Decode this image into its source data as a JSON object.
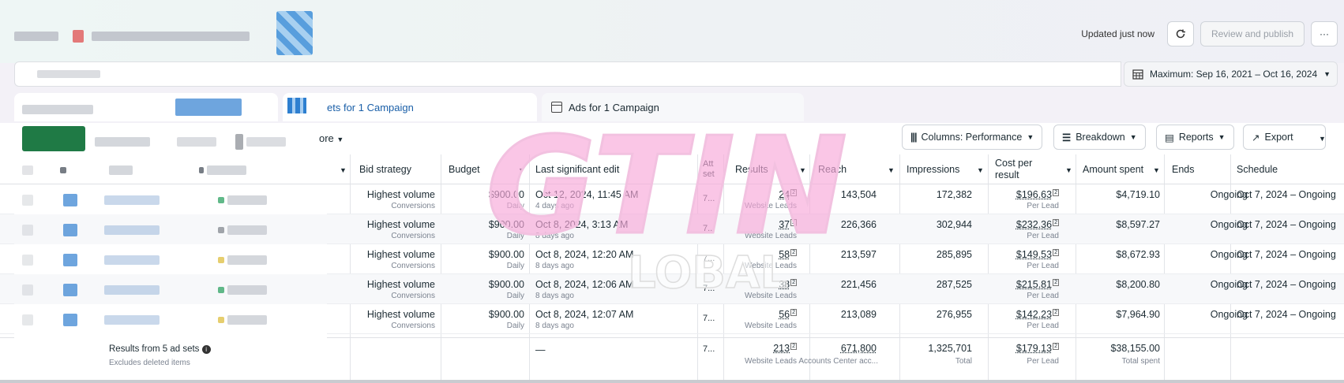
{
  "header": {
    "updated_text": "Updated just now",
    "review_label": "Review and publish",
    "more_label": "···"
  },
  "date_range": {
    "label": "Maximum: Sep 16, 2021 – Oct 16, 2024"
  },
  "tabs": [
    {
      "label": "ets for 1 Campaign",
      "active": true
    },
    {
      "label": "Ads for 1 Campaign",
      "active": false
    }
  ],
  "toolbar": {
    "more_label": "ore",
    "columns_label": "Columns: Performance",
    "breakdown_label": "Breakdown",
    "reports_label": "Reports",
    "export_label": "Export"
  },
  "columns": {
    "bid_strategy": "Bid strategy",
    "budget": "Budget",
    "last_edit": "Last significant edit",
    "attribution": "Att set",
    "results": "Results",
    "reach": "Reach",
    "impressions": "Impressions",
    "cost_per_result": "Cost per result",
    "amount_spent": "Amount spent",
    "ends": "Ends",
    "schedule": "Schedule"
  },
  "rows": [
    {
      "bid": "Highest volume",
      "bid_sub": "Conversions",
      "budget": "$900.00",
      "budget_sub": "Daily",
      "edit": "Oct 12, 2024, 11:45 AM",
      "edit_sub": "4 days ago",
      "attr": "7...",
      "results": "24",
      "results_sub": "Website Leads",
      "reach": "143,504",
      "impressions": "172,382",
      "cpr": "$196.63",
      "cpr_sub": "Per Lead",
      "spent": "$4,719.10",
      "ends": "Ongoing",
      "schedule": "Oct 7, 2024 – Ongoing"
    },
    {
      "bid": "Highest volume",
      "bid_sub": "Conversions",
      "budget": "$900.00",
      "budget_sub": "Daily",
      "edit": "Oct 8, 2024, 3:13 AM",
      "edit_sub": "8 days ago",
      "attr": "7...",
      "results": "37",
      "results_sub": "Website Leads",
      "reach": "226,366",
      "impressions": "302,944",
      "cpr": "$232.36",
      "cpr_sub": "Per Lead",
      "spent": "$8,597.27",
      "ends": "Ongoing",
      "schedule": "Oct 7, 2024 – Ongoing"
    },
    {
      "bid": "Highest volume",
      "bid_sub": "Conversions",
      "budget": "$900.00",
      "budget_sub": "Daily",
      "edit": "Oct 8, 2024, 12:20 AM",
      "edit_sub": "8 days ago",
      "attr": "7...",
      "results": "58",
      "results_sub": "Website Leads",
      "reach": "213,597",
      "impressions": "285,895",
      "cpr": "$149.53",
      "cpr_sub": "Per Lead",
      "spent": "$8,672.93",
      "ends": "Ongoing",
      "schedule": "Oct 7, 2024 – Ongoing"
    },
    {
      "bid": "Highest volume",
      "bid_sub": "Conversions",
      "budget": "$900.00",
      "budget_sub": "Daily",
      "edit": "Oct 8, 2024, 12:06 AM",
      "edit_sub": "8 days ago",
      "attr": "7...",
      "results": "38",
      "results_sub": "Website Leads",
      "reach": "221,456",
      "impressions": "287,525",
      "cpr": "$215.81",
      "cpr_sub": "Per Lead",
      "spent": "$8,200.80",
      "ends": "Ongoing",
      "schedule": "Oct 7, 2024 – Ongoing"
    },
    {
      "bid": "Highest volume",
      "bid_sub": "Conversions",
      "budget": "$900.00",
      "budget_sub": "Daily",
      "edit": "Oct 8, 2024, 12:07 AM",
      "edit_sub": "8 days ago",
      "attr": "7...",
      "results": "56",
      "results_sub": "Website Leads",
      "reach": "213,089",
      "impressions": "276,955",
      "cpr": "$142.23",
      "cpr_sub": "Per Lead",
      "spent": "$7,964.90",
      "ends": "Ongoing",
      "schedule": "Oct 7, 2024 – Ongoing"
    }
  ],
  "footer": {
    "title": "Results from 5 ad sets",
    "subtitle": "Excludes deleted items",
    "edit": "—",
    "attr": "7...",
    "results": "213",
    "results_sub": "Website Leads",
    "reach": "671,800",
    "reach_sub": "Accounts Center acc...",
    "impressions": "1,325,701",
    "impressions_sub": "Total",
    "cpr": "$179.13",
    "cpr_sub": "Per Lead",
    "spent": "$38,155.00",
    "spent_sub": "Total spent"
  },
  "watermark": {
    "text": "GTIN",
    "sub": "LOBAL",
    "color": "#f7a8d8"
  },
  "colors": {
    "accent": "#1a5fa8",
    "row_alt": "#f7f8fa"
  }
}
